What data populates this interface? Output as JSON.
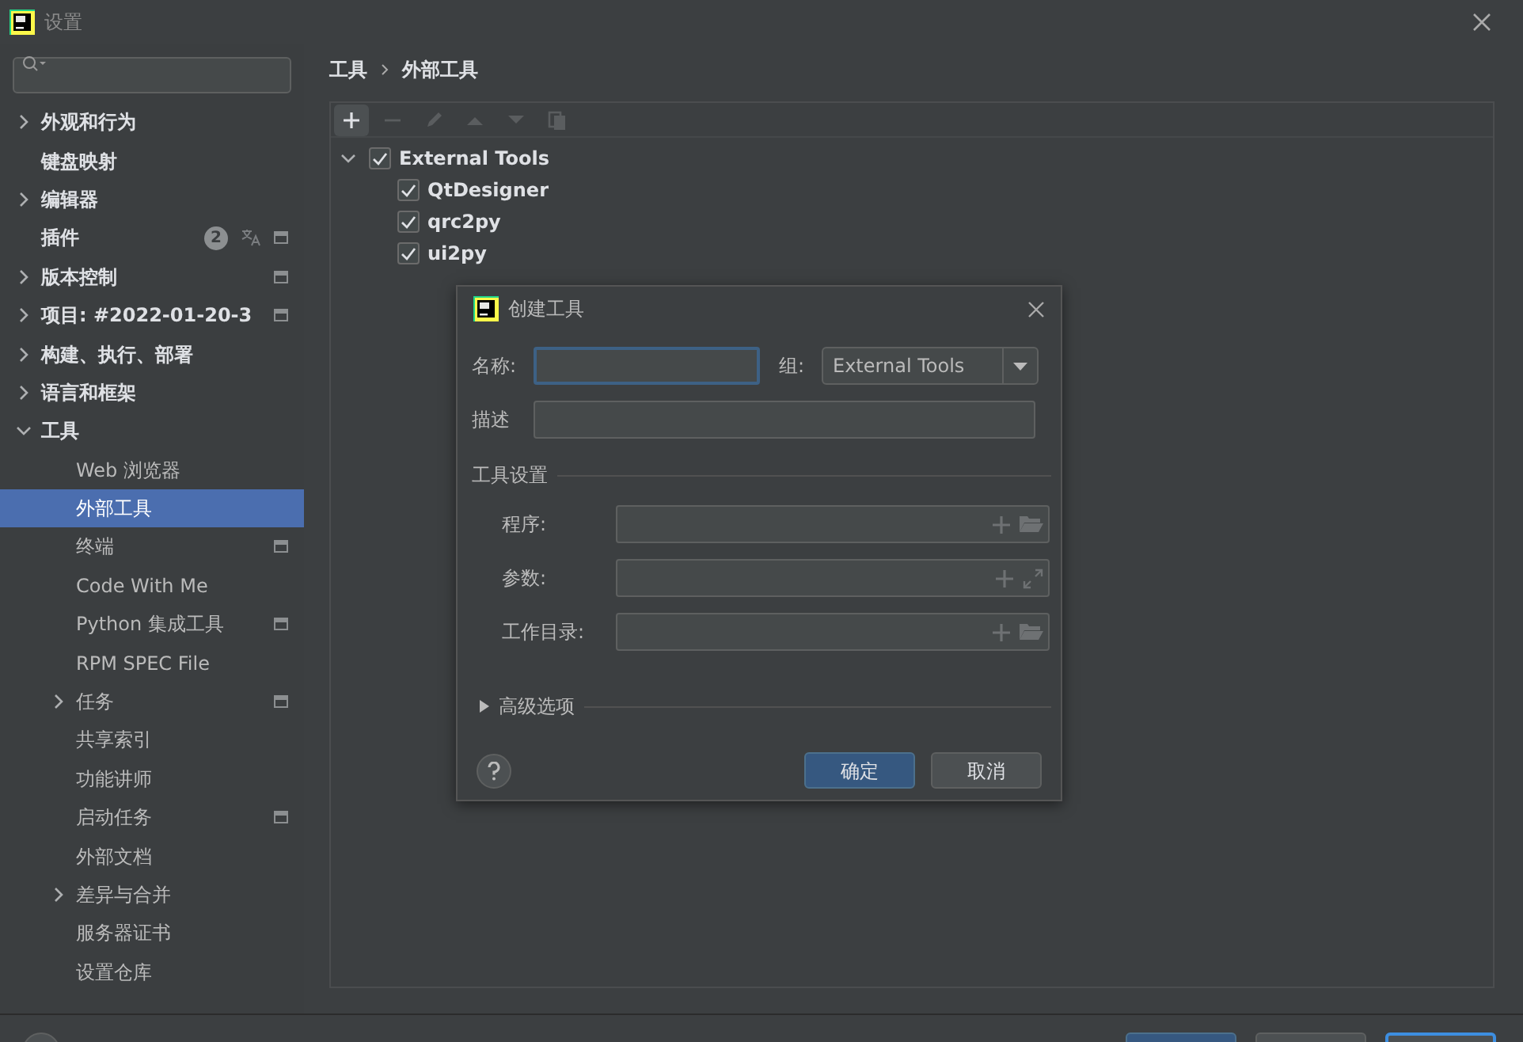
{
  "window": {
    "title": "设置"
  },
  "sidebar": {
    "items": [
      {
        "label": "外观和行为",
        "expanded": false
      },
      {
        "label": "键盘映射"
      },
      {
        "label": "编辑器",
        "expanded": false
      },
      {
        "label": "插件",
        "badge": "2",
        "translate": true,
        "project_scope": true
      },
      {
        "label": "版本控制",
        "expanded": false,
        "project_scope": true
      },
      {
        "label": "项目: #2022-01-20-3",
        "expanded": false,
        "project_scope": true
      },
      {
        "label": "构建、执行、部署",
        "expanded": false
      },
      {
        "label": "语言和框架",
        "expanded": false
      },
      {
        "label": "工具",
        "expanded": true,
        "children": [
          {
            "label": "Web 浏览器",
            "selected": false
          },
          {
            "label": "外部工具",
            "selected": true
          },
          {
            "label": "终端",
            "selected": false,
            "project_scope": true
          },
          {
            "label": "Code With Me",
            "selected": false
          },
          {
            "label": "Python 集成工具",
            "selected": false,
            "project_scope": true
          },
          {
            "label": "RPM SPEC File",
            "selected": false
          },
          {
            "label": "任务",
            "selected": false,
            "expanded": false,
            "project_scope": true
          },
          {
            "label": "共享索引",
            "selected": false
          },
          {
            "label": "功能讲师",
            "selected": false
          },
          {
            "label": "启动任务",
            "selected": false,
            "project_scope": true
          },
          {
            "label": "外部文档",
            "selected": false
          },
          {
            "label": "差异与合并",
            "selected": false,
            "expanded": false
          },
          {
            "label": "服务器证书",
            "selected": false
          },
          {
            "label": "设置仓库",
            "selected": false
          }
        ]
      }
    ]
  },
  "breadcrumb": [
    "工具",
    "外部工具"
  ],
  "toolbar": [
    {
      "kind": "add",
      "disabled": false
    },
    {
      "kind": "remove",
      "disabled": true
    },
    {
      "kind": "edit",
      "disabled": true
    },
    {
      "kind": "up",
      "disabled": true
    },
    {
      "kind": "down",
      "disabled": true
    },
    {
      "kind": "copy",
      "disabled": true
    }
  ],
  "tools_tree": {
    "label": "External Tools",
    "checked": true,
    "expanded": true,
    "children": [
      {
        "label": "QtDesigner",
        "checked": true
      },
      {
        "label": "qrc2py",
        "checked": true
      },
      {
        "label": "ui2py",
        "checked": true
      }
    ]
  },
  "dialog": {
    "title": "创建工具",
    "name_label": "名称:",
    "group_label": "组:",
    "group_value": "External Tools",
    "description_label": "描述",
    "section": "工具设置",
    "fields": [
      {
        "label": "程序:",
        "kind": "folder"
      },
      {
        "label": "参数:",
        "kind": "expand"
      },
      {
        "label": "工作目录:",
        "kind": "folder"
      }
    ],
    "advanced": {
      "label": "高级选项",
      "expanded": false
    },
    "ok": "确定",
    "cancel": "取消"
  }
}
